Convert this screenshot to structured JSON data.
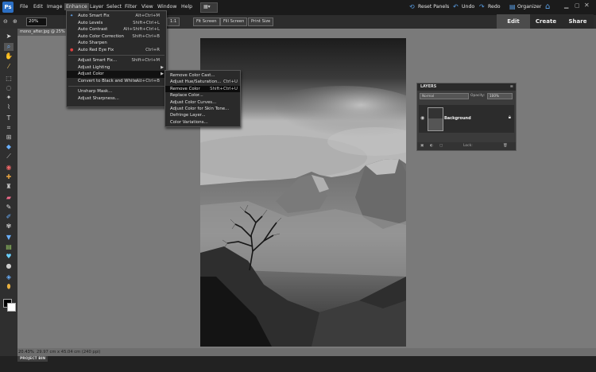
{
  "menubar": {
    "logo": "Ps",
    "items": [
      "File",
      "Edit",
      "Image",
      "Enhance",
      "Layer",
      "Select",
      "Filter",
      "View",
      "Window",
      "Help"
    ],
    "active": "Enhance",
    "actions": {
      "reset_panels": "Reset Panels",
      "undo": "Undo",
      "redo": "Redo",
      "organizer": "Organizer"
    }
  },
  "options": {
    "zoom": "20%",
    "buttons": [
      "1:1",
      "Fit Screen",
      "Fill Screen",
      "Print Size"
    ]
  },
  "tabs": {
    "edit": "Edit",
    "create": "Create",
    "share": "Share"
  },
  "document": {
    "tab_title": "mono_after.jpg @ 25% (Gray/8)",
    "zoom_status": "20.43%",
    "size": "29.97 cm x 45.04 cm (240 ppi)"
  },
  "project_bin": "PROJECT BIN",
  "enhance_menu": [
    {
      "label": "Auto Smart Fix",
      "shortcut": "Alt+Ctrl+M",
      "icon": "sparkle"
    },
    {
      "label": "Auto Levels",
      "shortcut": "Shift+Ctrl+L"
    },
    {
      "label": "Auto Contrast",
      "shortcut": "Alt+Shift+Ctrl+L"
    },
    {
      "label": "Auto Color Correction",
      "shortcut": "Shift+Ctrl+B"
    },
    {
      "label": "Auto Sharpen",
      "shortcut": ""
    },
    {
      "label": "Auto Red Eye Fix",
      "shortcut": "Ctrl+R",
      "icon": "eye"
    },
    {
      "sep": true
    },
    {
      "label": "Adjust Smart Fix...",
      "shortcut": "Shift+Ctrl+M"
    },
    {
      "label": "Adjust Lighting",
      "shortcut": "",
      "submenu": true
    },
    {
      "label": "Adjust Color",
      "shortcut": "",
      "submenu": true,
      "highlighted": true
    },
    {
      "label": "Convert to Black and White...",
      "shortcut": "Alt+Ctrl+B"
    },
    {
      "sep": true
    },
    {
      "label": "Unsharp Mask...",
      "shortcut": ""
    },
    {
      "label": "Adjust Sharpness...",
      "shortcut": ""
    }
  ],
  "color_submenu": [
    {
      "label": "Remove Color Cast...",
      "shortcut": ""
    },
    {
      "label": "Adjust Hue/Saturation...",
      "shortcut": "Ctrl+U"
    },
    {
      "label": "Remove Color",
      "shortcut": "Shift+Ctrl+U",
      "highlighted": true
    },
    {
      "label": "Replace Color...",
      "shortcut": ""
    },
    {
      "label": "Adjust Color Curves...",
      "shortcut": ""
    },
    {
      "label": "Adjust Color for Skin Tone...",
      "shortcut": ""
    },
    {
      "label": "Defringe Layer...",
      "shortcut": ""
    },
    {
      "label": "Color Variations...",
      "shortcut": ""
    }
  ],
  "layers_panel": {
    "title": "LAYERS",
    "blend_mode": "Normal",
    "opacity_label": "Opacity:",
    "opacity": "100%",
    "layer_name": "Background",
    "lock_label": "Lock:"
  },
  "colors": {
    "accent": "#2b6fc4",
    "menu_bg": "#2a2a2a",
    "highlight": "#111111",
    "canvas": "#7a7a7a"
  }
}
